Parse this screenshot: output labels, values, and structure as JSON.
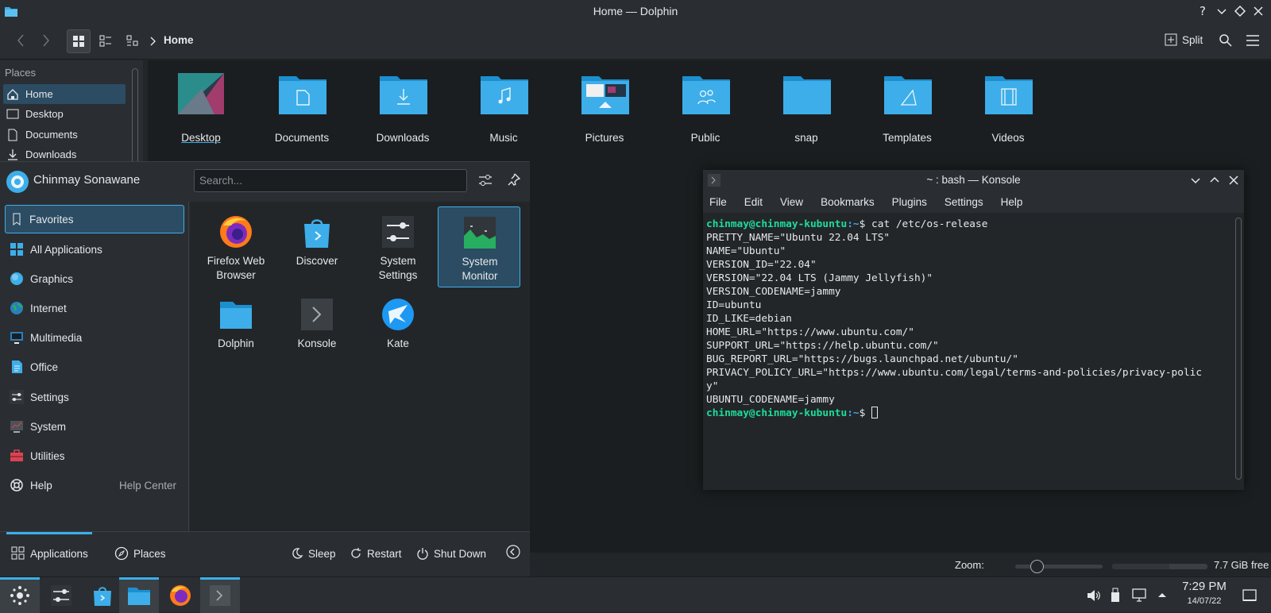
{
  "dolphin": {
    "title": "Home — Dolphin",
    "breadcrumb": "Home",
    "split_label": "Split",
    "places_header": "Places",
    "places": [
      {
        "label": "Home",
        "icon": "home-icon"
      },
      {
        "label": "Desktop",
        "icon": "desktop-icon"
      },
      {
        "label": "Documents",
        "icon": "documents-icon"
      },
      {
        "label": "Downloads",
        "icon": "downloads-icon"
      }
    ],
    "files": [
      "Desktop",
      "Documents",
      "Downloads",
      "Music",
      "Pictures",
      "Public",
      "snap",
      "Templates",
      "Videos"
    ],
    "status": {
      "zoom_label": "Zoom:",
      "free_space": "7.7 GiB free"
    }
  },
  "konsole": {
    "title": "~ : bash — Konsole",
    "menu": [
      "File",
      "Edit",
      "View",
      "Bookmarks",
      "Plugins",
      "Settings",
      "Help"
    ],
    "prompt_user": "chinmay@chinmay-kubuntu",
    "prompt_path": ":~",
    "command": "$ cat /etc/os-release",
    "output": [
      "PRETTY_NAME=\"Ubuntu 22.04 LTS\"",
      "NAME=\"Ubuntu\"",
      "VERSION_ID=\"22.04\"",
      "VERSION=\"22.04 LTS (Jammy Jellyfish)\"",
      "VERSION_CODENAME=jammy",
      "ID=ubuntu",
      "ID_LIKE=debian",
      "HOME_URL=\"https://www.ubuntu.com/\"",
      "SUPPORT_URL=\"https://help.ubuntu.com/\"",
      "BUG_REPORT_URL=\"https://bugs.launchpad.net/ubuntu/\"",
      "PRIVACY_POLICY_URL=\"https://www.ubuntu.com/legal/terms-and-policies/privacy-polic",
      "y\"",
      "UBUNTU_CODENAME=jammy"
    ],
    "prompt_end": "$ "
  },
  "launcher": {
    "user_name": "Chinmay Sonawane",
    "search_placeholder": "Search...",
    "categories": [
      {
        "label": "Favorites",
        "extra": ""
      },
      {
        "label": "All Applications",
        "extra": ""
      },
      {
        "label": "Graphics",
        "extra": ""
      },
      {
        "label": "Internet",
        "extra": ""
      },
      {
        "label": "Multimedia",
        "extra": ""
      },
      {
        "label": "Office",
        "extra": ""
      },
      {
        "label": "Settings",
        "extra": ""
      },
      {
        "label": "System",
        "extra": ""
      },
      {
        "label": "Utilities",
        "extra": ""
      },
      {
        "label": "Help",
        "extra": "Help Center"
      }
    ],
    "apps": [
      {
        "line1": "Firefox Web",
        "line2": "Browser"
      },
      {
        "line1": "Discover",
        "line2": ""
      },
      {
        "line1": "System",
        "line2": "Settings"
      },
      {
        "line1": "System",
        "line2": "Monitor"
      },
      {
        "line1": "Dolphin",
        "line2": ""
      },
      {
        "line1": "Konsole",
        "line2": ""
      },
      {
        "line1": "Kate",
        "line2": ""
      }
    ],
    "footer": {
      "applications": "Applications",
      "places": "Places",
      "sleep": "Sleep",
      "restart": "Restart",
      "shutdown": "Shut Down"
    }
  },
  "taskbar": {
    "time": "7:29 PM",
    "date": "14/07/22"
  },
  "colors": {
    "accent": "#3daee9",
    "folder": "#3daee9",
    "selection": "#2b4c63",
    "prompt_user": "#1cdc9a"
  }
}
